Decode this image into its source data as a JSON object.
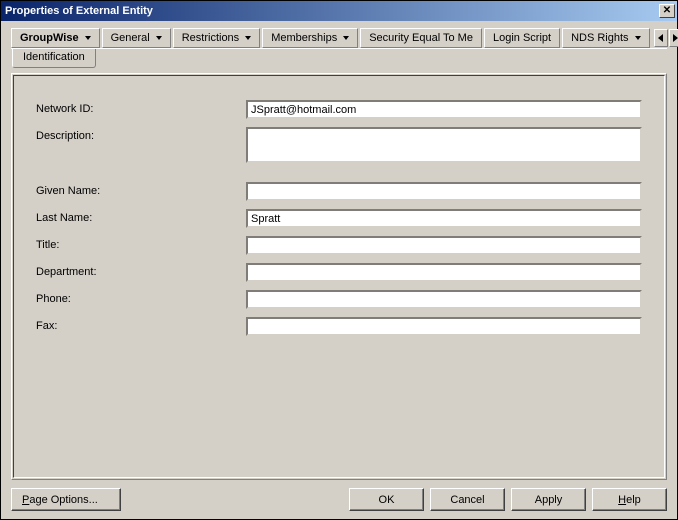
{
  "window": {
    "title": "Properties of External Entity"
  },
  "tabs": {
    "groupwise": "GroupWise",
    "general": "General",
    "restrictions": "Restrictions",
    "memberships": "Memberships",
    "security": "Security Equal To Me",
    "login": "Login Script",
    "nds": "NDS Rights"
  },
  "subtab": {
    "identification": "Identification"
  },
  "labels": {
    "network_id": "Network ID:",
    "description": "Description:",
    "given_name": "Given Name:",
    "last_name": "Last Name:",
    "title": "Title:",
    "department": "Department:",
    "phone": "Phone:",
    "fax": "Fax:"
  },
  "values": {
    "network_id": "JSpratt@hotmail.com",
    "description": "",
    "given_name": "",
    "last_name": "Spratt",
    "title": "",
    "department": "",
    "phone": "",
    "fax": ""
  },
  "buttons": {
    "page_options": "Page Options...",
    "ok": "OK",
    "cancel": "Cancel",
    "apply": "Apply",
    "help": "Help"
  }
}
